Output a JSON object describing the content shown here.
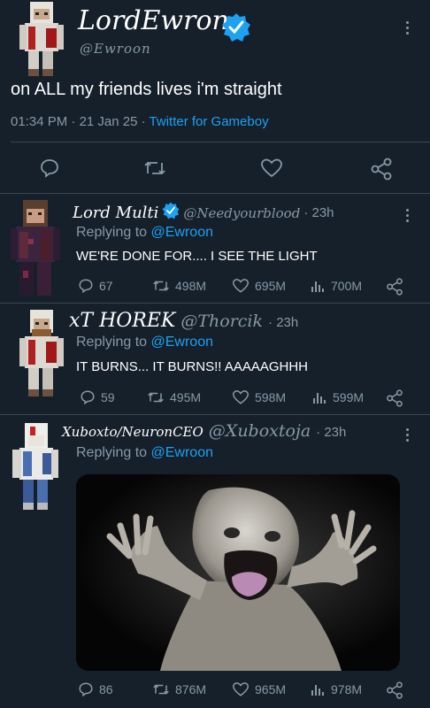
{
  "main_tweet": {
    "display_name": "LordEwron",
    "handle": "@Ewroon",
    "text": "on ALL my friends lives i'm straight",
    "time": "01:34 PM",
    "sep1": "·",
    "date": "21 Jan 25",
    "sep2": "·",
    "source": "Twitter for Gameboy"
  },
  "replies": [
    {
      "display_name": "Lord Multi",
      "handle": "@Needyourblood",
      "age": "· 23h",
      "replying_prefix": "Replying to",
      "replying_to": "@Ewroon",
      "text": "WE'RE DONE FOR.... I SEE THE LIGHT",
      "replies_count": "67",
      "retweets": "498M",
      "likes": "695M",
      "views": "700M"
    },
    {
      "display_name": "xT HOREK",
      "handle": "@Thorcik",
      "age": "· 23h",
      "replying_prefix": "Replying to",
      "replying_to": "@Ewroon",
      "text": "IT BURNS... IT BURNS!! AAAAAGHHH",
      "replies_count": "59",
      "retweets": "495M",
      "likes": "598M",
      "views": "599M"
    },
    {
      "display_name": "Xuboxto/NeuronCEO",
      "handle": "@Xuboxtoja",
      "age": "· 23h",
      "replying_prefix": "Replying to",
      "replying_to": "@Ewroon",
      "text": "",
      "replies_count": "86",
      "retweets": "876M",
      "likes": "965M",
      "views": "978M"
    }
  ],
  "colors": {
    "background": "#15202b",
    "muted": "#8899a6",
    "accent": "#1da1f2",
    "divider": "#38444d"
  },
  "icons": [
    "verified-badge-icon",
    "comment-icon",
    "retweet-icon",
    "like-icon",
    "share-icon",
    "views-icon",
    "more-icon"
  ]
}
